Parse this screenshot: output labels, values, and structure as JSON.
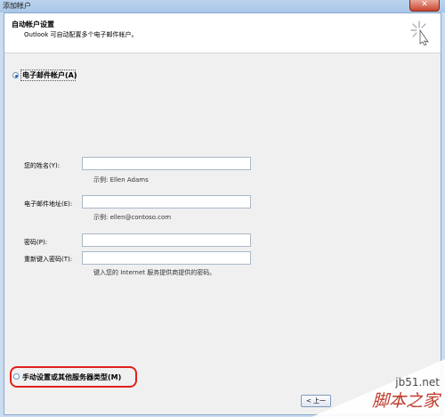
{
  "window": {
    "title": "添加帐户",
    "close_symbol": "✕"
  },
  "header": {
    "title": "自动帐户设置",
    "subtitle": "Outlook 可自动配置多个电子邮件帐户。"
  },
  "options": {
    "email_account": {
      "label": "电子邮件帐户(A)",
      "selected": true
    },
    "manual_setup": {
      "label": "手动设置或其他服务器类型(M)",
      "selected": false
    }
  },
  "form": {
    "name": {
      "label": "您的姓名(Y):",
      "value": "",
      "hint": "示例: Ellen Adams"
    },
    "email": {
      "label": "电子邮件地址(E):",
      "value": "",
      "hint": "示例: ellen@contoso.com"
    },
    "password": {
      "label": "密码(P):",
      "value": ""
    },
    "retype_password": {
      "label": "重新键入密码(T):",
      "value": "",
      "hint": "键入您的 Internet 服务提供商提供的密码。"
    }
  },
  "nav": {
    "back_label": "< 上一"
  },
  "watermark": {
    "site": "jb51.net",
    "name": "脚本之家"
  },
  "colors": {
    "highlight": "#e0201a",
    "title_bar": "#bcd3ee"
  }
}
